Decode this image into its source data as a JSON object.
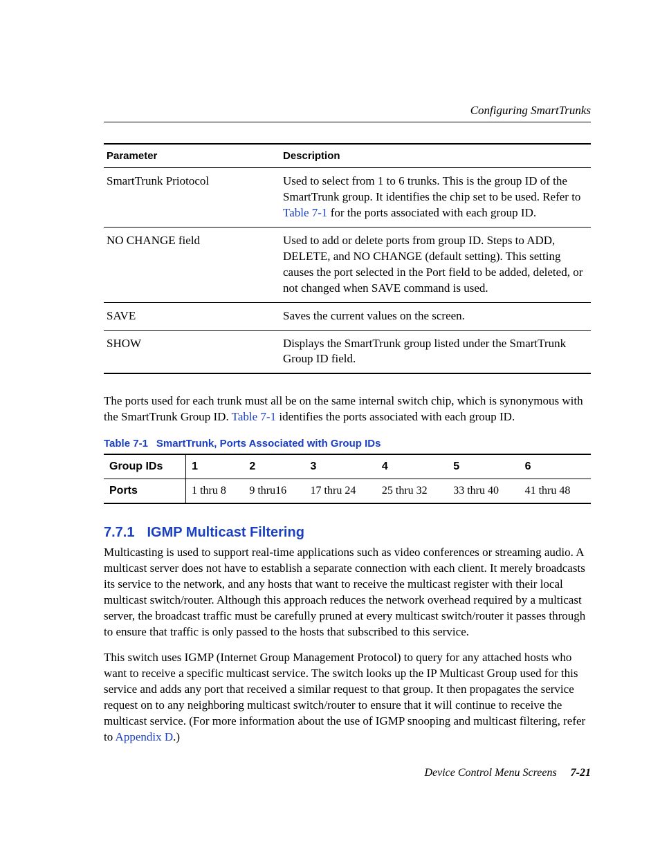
{
  "header": {
    "running": "Configuring SmartTrunks"
  },
  "paramTable": {
    "headers": {
      "param": "Parameter",
      "desc": "Description"
    },
    "rows": [
      {
        "param": "SmartTrunk Priotocol",
        "desc_a": "Used to select from 1 to 6 trunks. This is the group ID of the SmartTrunk group. It identifies the chip set to be used. Refer to ",
        "xref": "Table 7-1",
        "desc_b": " for the ports associated with each group ID."
      },
      {
        "param": "NO CHANGE field",
        "desc_a": "Used to add or delete ports from group ID. Steps to ADD, DELETE, and NO CHANGE (default setting). This setting causes the port selected in the Port field to be added, deleted, or not changed when SAVE command is used.",
        "xref": "",
        "desc_b": ""
      },
      {
        "param": "SAVE",
        "desc_a": "Saves the current values on the screen.",
        "xref": "",
        "desc_b": ""
      },
      {
        "param": "SHOW",
        "desc_a": "Displays the SmartTrunk group listed under the SmartTrunk Group ID field.",
        "xref": "",
        "desc_b": ""
      }
    ]
  },
  "para1": {
    "a": "The ports used for each trunk must all be on the same internal switch chip, which is synonymous with the SmartTrunk Group ID. ",
    "xref": "Table 7-1",
    "b": " identifies the ports associated with each group ID."
  },
  "table71": {
    "label": "Table 7-1",
    "title": "SmartTrunk, Ports Associated with Group IDs",
    "rowHeaders": {
      "r1": "Group IDs",
      "r2": "Ports"
    },
    "cols": [
      "1",
      "2",
      "3",
      "4",
      "5",
      "6"
    ],
    "ports": [
      "1 thru 8",
      "9 thru16",
      "17 thru 24",
      "25 thru 32",
      "33 thru 40",
      "41 thru 48"
    ]
  },
  "section": {
    "num": "7.7.1",
    "title": "IGMP Multicast Filtering",
    "p1": "Multicasting is used to support real-time applications such as video conferences or streaming audio. A multicast server does not have to establish a separate connection with each client. It merely broadcasts its service to the network, and any hosts that want to receive the multicast register with their local multicast switch/router. Although this approach reduces the network overhead required by a multicast server, the broadcast traffic must be carefully pruned at every multicast switch/router it passes through to ensure that traffic is only passed to the hosts that subscribed to this service.",
    "p2a": "This switch uses IGMP (Internet Group Management Protocol) to query for any attached hosts who want to receive a specific multicast service. The switch looks up the IP Multicast Group used for this service and adds any port that received a similar request to that group. It then propagates the service request on to any neighboring multicast switch/router to ensure that it will continue to receive the multicast service. (For more information about the use of IGMP snooping and multicast filtering, refer to ",
    "p2xref": "Appendix D",
    "p2b": ".)"
  },
  "footer": {
    "title": "Device Control Menu Screens",
    "page": "7-21"
  }
}
